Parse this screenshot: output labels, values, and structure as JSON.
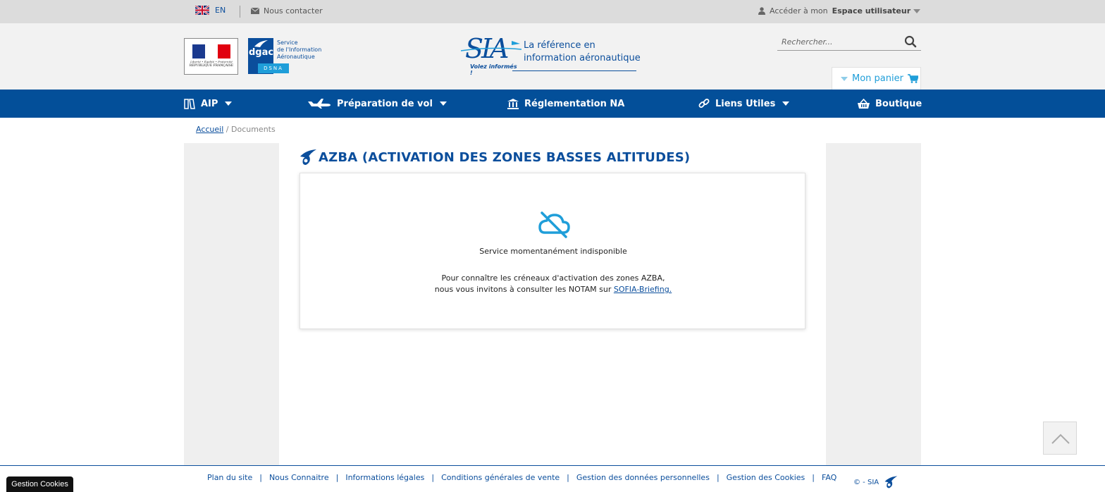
{
  "topbar": {
    "lang_code": "EN",
    "contact": "Nous contacter",
    "account_prefix": "Accéder à mon",
    "account_bold": "Espace utilisateur"
  },
  "header": {
    "rf_motto": "Liberté • Égalité • Fraternité",
    "rf_name": "RÉPUBLIQUE FRANÇAISE",
    "dgac_word": "dgac",
    "dgac_line1": "Service",
    "dgac_line2": "de l'Information",
    "dgac_line3": "Aéronautique",
    "dsna": "DSNA",
    "sia_slogan": "Volez informés !",
    "tagline_line1": "La référence en",
    "tagline_line2": "information aéronautique"
  },
  "search": {
    "placeholder": "Rechercher..."
  },
  "cart": {
    "label": "Mon panier"
  },
  "nav": {
    "aip": "AIP",
    "preparation": "Préparation de vol",
    "reglementation": "Réglementation NA",
    "liens": "Liens Utiles",
    "boutique": "Boutique"
  },
  "breadcrumb": {
    "home": "Accueil",
    "separator": "/",
    "current": "Documents"
  },
  "page": {
    "title": "AZBA (ACTIVATION DES ZONES BASSES ALTITUDES)"
  },
  "service": {
    "status": "Service momentanément indisponible",
    "msg_line1": "Pour connaître les créneaux d'activation des zones AZBA,",
    "msg_line2_prefix": "nous vous invitons à consulter les NOTAM sur",
    "msg_link": "SOFIA-Briefing."
  },
  "footer": {
    "links": [
      "Plan du site",
      "Nous Connaitre",
      "Informations légales",
      "Conditions générales de vente",
      "Gestion des données personnelles",
      "Gestion des Cookies",
      "FAQ"
    ],
    "copyright": "© - SIA"
  },
  "cookies_button": "Gestion Cookies",
  "colors": {
    "brand_blue": "#034f99",
    "link_blue": "#0b4e9c",
    "accent_cyan": "#1f9ed9"
  }
}
